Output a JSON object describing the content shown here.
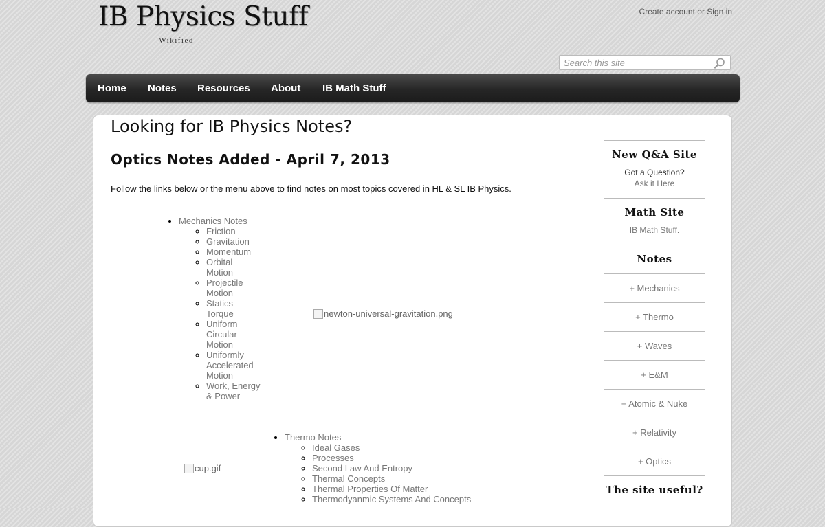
{
  "header": {
    "site_title": "IB Physics Stuff",
    "site_subtitle": "- Wikified -",
    "create_account": "Create account",
    "or_text": "or",
    "sign_in": "Sign in"
  },
  "search": {
    "placeholder": "Search this site",
    "value": "",
    "icon": "search-icon"
  },
  "nav": {
    "items": [
      "Home",
      "Notes",
      "Resources",
      "About",
      "IB Math Stuff"
    ]
  },
  "main": {
    "page_title": "Looking for IB Physics Notes?",
    "section_heading": "Optics Notes Added - April 7, 2013",
    "intro": "Follow the links below or the menu above to find notes on most topics covered in HL & SL IB Physics.",
    "mechanics": {
      "label": "Mechanics Notes",
      "items": [
        "Friction",
        "Gravitation",
        "Momentum",
        "Orbital Motion",
        "Projectile Motion",
        "Statics Torque",
        "Uniform Circular Motion",
        "Uniformly Accelerated Motion",
        "Work, Energy & Power"
      ]
    },
    "mechanics_image_alt": "newton-universal-gravitation.png",
    "thermo": {
      "label": "Thermo Notes",
      "items": [
        "Ideal Gases",
        "Processes",
        "Second Law And Entropy",
        "Thermal Concepts",
        "Thermal Properties Of Matter",
        "Thermodyanmic Systems And Concepts"
      ]
    },
    "thermo_image_alt": "cup.gif"
  },
  "sidebar": {
    "qa_title": "New Q&A Site",
    "qa_text": "Got a Question?",
    "qa_link": "Ask it Here",
    "math_title": "Math Site",
    "math_link": "IB Math Stuff.",
    "notes_title": "Notes",
    "notes_links": [
      "+ Mechanics",
      "+ Thermo",
      "+ Waves",
      "+ E&M",
      "+ Atomic & Nuke",
      "+ Relativity",
      "+ Optics"
    ],
    "useful_title": "The site useful?"
  }
}
